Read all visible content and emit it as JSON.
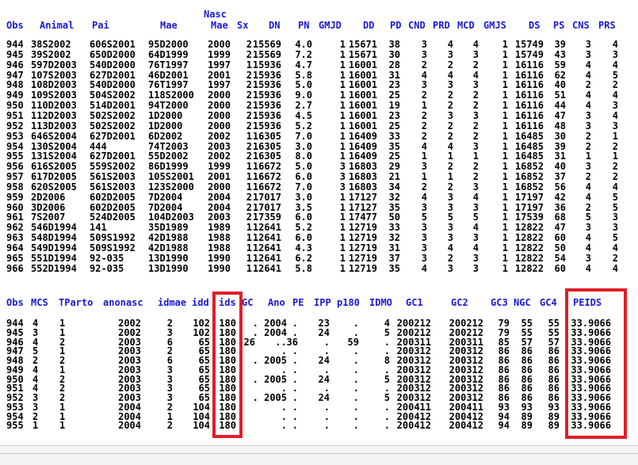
{
  "top_table": {
    "header_line1": [
      {
        "key": "nasc",
        "text": "Nasc"
      }
    ],
    "columns": [
      {
        "key": "obs",
        "text": "Obs"
      },
      {
        "key": "animal",
        "text": "Animal"
      },
      {
        "key": "pai",
        "text": "Pai"
      },
      {
        "key": "mae",
        "text": "Mae"
      },
      {
        "key": "nascmae",
        "text": "Mae"
      },
      {
        "key": "sx",
        "text": "Sx"
      },
      {
        "key": "dn",
        "text": "DN"
      },
      {
        "key": "pn",
        "text": "PN"
      },
      {
        "key": "gmjd",
        "text": "GMJD"
      },
      {
        "key": "dd",
        "text": "DD"
      },
      {
        "key": "pd",
        "text": "PD"
      },
      {
        "key": "cnd",
        "text": "CND"
      },
      {
        "key": "prd",
        "text": "PRD"
      },
      {
        "key": "mcd",
        "text": "MCD"
      },
      {
        "key": "gmjs",
        "text": "GMJS"
      },
      {
        "key": "ds",
        "text": "DS"
      },
      {
        "key": "ps",
        "text": "PS"
      },
      {
        "key": "cns",
        "text": "CNS"
      },
      {
        "key": "prs",
        "text": "PRS"
      }
    ],
    "rows": [
      [
        "944",
        "38S2002",
        "606S2001",
        "95D2000",
        "2000",
        "2",
        "15569",
        "4.0",
        "1",
        "15671",
        "38",
        "3",
        "4",
        "4",
        "1",
        "15749",
        "39",
        "3",
        "4"
      ],
      [
        "945",
        "39S2002",
        "650D2000",
        "64D1999",
        "1999",
        "2",
        "15569",
        "7.2",
        "1",
        "15671",
        "30",
        "3",
        "3",
        "3",
        "1",
        "15749",
        "43",
        "3",
        "3"
      ],
      [
        "946",
        "597D2003",
        "540D2000",
        "76T1997",
        "1997",
        "1",
        "15936",
        "4.7",
        "1",
        "16001",
        "28",
        "2",
        "2",
        "2",
        "1",
        "16116",
        "59",
        "4",
        "4"
      ],
      [
        "947",
        "107S2003",
        "627D2001",
        "46D2001",
        "2001",
        "2",
        "15936",
        "5.8",
        "1",
        "16001",
        "31",
        "4",
        "4",
        "4",
        "1",
        "16116",
        "62",
        "4",
        "5"
      ],
      [
        "948",
        "108D2003",
        "540D2000",
        "76T1997",
        "1997",
        "2",
        "15936",
        "5.0",
        "1",
        "16001",
        "23",
        "3",
        "3",
        "3",
        "1",
        "16116",
        "40",
        "2",
        "2"
      ],
      [
        "949",
        "109S2003",
        "504S2002",
        "118S2000",
        "2000",
        "2",
        "15936",
        "9.0",
        "1",
        "16001",
        "25",
        "2",
        "2",
        "2",
        "1",
        "16116",
        "51",
        "4",
        "4"
      ],
      [
        "950",
        "110D2003",
        "514D2001",
        "94T2000",
        "2000",
        "2",
        "15936",
        "2.7",
        "1",
        "16001",
        "19",
        "1",
        "2",
        "2",
        "1",
        "16116",
        "44",
        "4",
        "3"
      ],
      [
        "951",
        "112D2003",
        "502S2002",
        "1D2000",
        "2000",
        "2",
        "15936",
        "4.5",
        "1",
        "16001",
        "23",
        "2",
        "3",
        "3",
        "1",
        "16116",
        "47",
        "3",
        "4"
      ],
      [
        "952",
        "113D2003",
        "502S2002",
        "1D2000",
        "2000",
        "2",
        "15936",
        "5.2",
        "1",
        "16001",
        "25",
        "2",
        "2",
        "2",
        "1",
        "16116",
        "48",
        "3",
        "3"
      ],
      [
        "953",
        "646S2004",
        "627D2001",
        "6D2002",
        "2002",
        "1",
        "16305",
        "7.0",
        "1",
        "16409",
        "33",
        "2",
        "2",
        "2",
        "1",
        "16485",
        "30",
        "2",
        "1"
      ],
      [
        "954",
        "130S2004",
        "444",
        "74T2003",
        "2003",
        "2",
        "16305",
        "3.0",
        "1",
        "16409",
        "35",
        "4",
        "4",
        "3",
        "1",
        "16485",
        "39",
        "2",
        "2"
      ],
      [
        "955",
        "131S2004",
        "627D2001",
        "55D2002",
        "2002",
        "2",
        "16305",
        "8.0",
        "1",
        "16409",
        "25",
        "1",
        "1",
        "1",
        "1",
        "16485",
        "31",
        "1",
        "1"
      ],
      [
        "956",
        "616S2005",
        "559S2002",
        "86D1999",
        "1999",
        "1",
        "16672",
        "5.0",
        "3",
        "16803",
        "29",
        "3",
        "2",
        "2",
        "1",
        "16852",
        "40",
        "3",
        "2"
      ],
      [
        "957",
        "617D2005",
        "561S2003",
        "105S2001",
        "2001",
        "1",
        "16672",
        "6.0",
        "3",
        "16803",
        "21",
        "1",
        "1",
        "2",
        "1",
        "16852",
        "37",
        "2",
        "2"
      ],
      [
        "958",
        "620S2005",
        "561S2003",
        "123S2000",
        "2000",
        "1",
        "16672",
        "7.0",
        "3",
        "16803",
        "34",
        "2",
        "2",
        "3",
        "1",
        "16852",
        "56",
        "4",
        "4"
      ],
      [
        "959",
        "2D2006",
        "602D2005",
        "7D2004",
        "2004",
        "2",
        "17017",
        "3.0",
        "1",
        "17127",
        "32",
        "4",
        "3",
        "4",
        "1",
        "17197",
        "42",
        "4",
        "5"
      ],
      [
        "960",
        "3D2006",
        "602D2005",
        "7D2004",
        "2004",
        "2",
        "17017",
        "3.5",
        "1",
        "17127",
        "35",
        "3",
        "3",
        "3",
        "1",
        "17197",
        "36",
        "2",
        "5"
      ],
      [
        "961",
        "7S2007",
        "",
        "524D2005",
        "104D2003",
        "2003",
        "2",
        "17359",
        "6.0",
        "1",
        "17477",
        "50",
        "5",
        "5",
        "5",
        "1",
        "17539",
        "68",
        "5",
        "3"
      ],
      [
        "962",
        "546D1994",
        "141",
        "35D1989",
        "1989",
        "1",
        "12641",
        "5.2",
        "1",
        "12719",
        "33",
        "3",
        "3",
        "4",
        "1",
        "12822",
        "47",
        "3",
        "3"
      ],
      [
        "963",
        "548D1994",
        "509S1992",
        "42D1988",
        "1988",
        "1",
        "12641",
        "6.0",
        "1",
        "12719",
        "32",
        "3",
        "3",
        "3",
        "1",
        "12822",
        "60",
        "4",
        "5"
      ],
      [
        "964",
        "549D1994",
        "509S1992",
        "42D1988",
        "1988",
        "1",
        "12641",
        "4.3",
        "1",
        "12719",
        "31",
        "3",
        "4",
        "4",
        "1",
        "12822",
        "50",
        "4",
        "4"
      ],
      [
        "965",
        "551D1994",
        "92-035",
        "13D1990",
        "1990",
        "1",
        "12641",
        "6.2",
        "1",
        "12719",
        "37",
        "3",
        "2",
        "3",
        "1",
        "12822",
        "54",
        "3",
        "2"
      ],
      [
        "966",
        "552D1994",
        "92-035",
        "13D1990",
        "1990",
        "1",
        "12641",
        "5.8",
        "1",
        "12719",
        "35",
        "4",
        "3",
        "3",
        "1",
        "12822",
        "60",
        "4",
        "4"
      ]
    ]
  },
  "bottom_table": {
    "columns": [
      {
        "key": "obs",
        "text": "Obs"
      },
      {
        "key": "mcs",
        "text": "MCS"
      },
      {
        "key": "tparto",
        "text": "TParto"
      },
      {
        "key": "anonasc",
        "text": "anonasc"
      },
      {
        "key": "idmae",
        "text": "idmae"
      },
      {
        "key": "idd",
        "text": "idd"
      },
      {
        "key": "ids",
        "text": "ids"
      },
      {
        "key": "gc",
        "text": "GC"
      },
      {
        "key": "ano",
        "text": "Ano"
      },
      {
        "key": "pe",
        "text": "PE"
      },
      {
        "key": "ipp",
        "text": "IPP"
      },
      {
        "key": "p180",
        "text": "p180"
      },
      {
        "key": "idmo",
        "text": "IDMO"
      },
      {
        "key": "gc1",
        "text": "GC1"
      },
      {
        "key": "gc2",
        "text": "GC2"
      },
      {
        "key": "gc3",
        "text": "GC3"
      },
      {
        "key": "ngc",
        "text": "NGC"
      },
      {
        "key": "gc4",
        "text": "GC4"
      },
      {
        "key": "peids",
        "text": "PEIDS"
      }
    ],
    "rows": [
      [
        "944",
        "4",
        "1",
        "2002",
        "2",
        "102",
        "180",
        "",
        ". 2004",
        ".",
        "23",
        ".",
        "4",
        "200212",
        "200212",
        "79",
        "55",
        "55",
        "33.9066"
      ],
      [
        "945",
        "3",
        "1",
        "2002",
        "3",
        "102",
        "180",
        "",
        ". 2004",
        ".",
        "24",
        ".",
        "5",
        "200212",
        "200212",
        "79",
        "55",
        "55",
        "33.9066"
      ],
      [
        "946",
        "4",
        "2",
        "2003",
        "6",
        "65",
        "180",
        "26",
        ".",
        ". 36",
        ".",
        "59",
        ".",
        "200311",
        "200311",
        "85",
        "57",
        "57",
        "33.9066"
      ],
      [
        "947",
        "5",
        "1",
        "2003",
        "2",
        "65",
        "180",
        "",
        ".",
        ".",
        ".",
        ".",
        ".",
        "200312",
        "200312",
        "86",
        "86",
        "86",
        "33.9066"
      ],
      [
        "948",
        "2",
        "2",
        "2003",
        "6",
        "65",
        "180",
        "",
        ". 2005",
        ".",
        "24",
        ".",
        "8",
        "200312",
        "200312",
        "86",
        "86",
        "86",
        "33.9066"
      ],
      [
        "949",
        "4",
        "1",
        "2003",
        "3",
        "65",
        "180",
        "",
        ".",
        ".",
        ".",
        ".",
        ".",
        "200312",
        "200312",
        "86",
        "86",
        "86",
        "33.9066"
      ],
      [
        "950",
        "4",
        "2",
        "2003",
        "3",
        "65",
        "180",
        "",
        ". 2005",
        ".",
        "24",
        ".",
        "5",
        "200312",
        "200312",
        "86",
        "86",
        "86",
        "33.9066"
      ],
      [
        "951",
        "4",
        "2",
        "2003",
        "3",
        "65",
        "180",
        "",
        ".",
        ".",
        ".",
        ".",
        ".",
        "200312",
        "200312",
        "86",
        "86",
        "86",
        "33.9066"
      ],
      [
        "952",
        "3",
        "2",
        "2003",
        "3",
        "65",
        "180",
        "",
        ". 2005",
        ".",
        "24",
        ".",
        "5",
        "200312",
        "200312",
        "86",
        "86",
        "86",
        "33.9066"
      ],
      [
        "953",
        "3",
        "1",
        "2004",
        "2",
        "104",
        "180",
        "",
        ".",
        ".",
        ".",
        ".",
        ".",
        "200411",
        "200411",
        "93",
        "93",
        "93",
        "33.9066"
      ],
      [
        "954",
        "2",
        "1",
        "2004",
        "1",
        "104",
        "180",
        "",
        ".",
        ".",
        ".",
        ".",
        ".",
        "200412",
        "200412",
        "94",
        "89",
        "89",
        "33.9066"
      ],
      [
        "955",
        "1",
        "1",
        "2004",
        "2",
        "104",
        "180",
        "",
        ".",
        ".",
        ".",
        ".",
        ".",
        "200412",
        "200412",
        "94",
        "89",
        "89",
        "33.9066"
      ]
    ]
  },
  "highlight": {
    "color": "#e11d2a",
    "targets": [
      "ids",
      "PEIDS"
    ]
  },
  "colors": {
    "header": "#1a1ad6",
    "cell": "#000000",
    "background": "#ffffff"
  }
}
